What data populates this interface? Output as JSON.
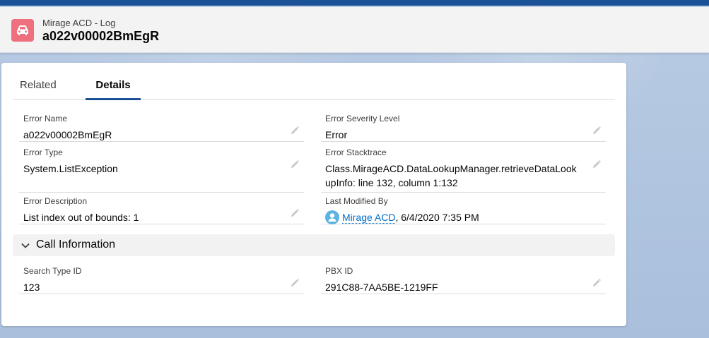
{
  "header": {
    "object_name": "Mirage ACD - Log",
    "record_name": "a022v00002BmEgR",
    "icon": "car-icon",
    "icon_color": "#ee6f7d"
  },
  "tabs": [
    {
      "label": "Related",
      "active": false
    },
    {
      "label": "Details",
      "active": true
    }
  ],
  "fields": {
    "error_name": {
      "label": "Error Name",
      "value": "a022v00002BmEgR"
    },
    "error_severity": {
      "label": "Error Severity Level",
      "value": "Error"
    },
    "error_type": {
      "label": "Error Type",
      "value": "System.ListException"
    },
    "error_stacktrace": {
      "label": "Error Stacktrace",
      "line1": "Class.MirageACD.DataLookupManager.retrieveDataLook",
      "line2": "upInfo: line 132, column 1:132"
    },
    "error_description": {
      "label": "Error Description",
      "value": "List index out of bounds: 1"
    },
    "last_modified": {
      "label": "Last Modified By",
      "user": "Mirage ACD",
      "date": ", 6/4/2020 7:35 PM"
    }
  },
  "call_section": {
    "title": "Call Information",
    "fields": {
      "search_type_id": {
        "label": "Search Type ID",
        "value": "123"
      },
      "pbx_id": {
        "label": "PBX ID",
        "value": "291C88-7AA5BE-1219FF"
      }
    }
  },
  "colors": {
    "brand": "#1b5297",
    "link": "#006dcc",
    "avatar": "#5fb3e0"
  }
}
